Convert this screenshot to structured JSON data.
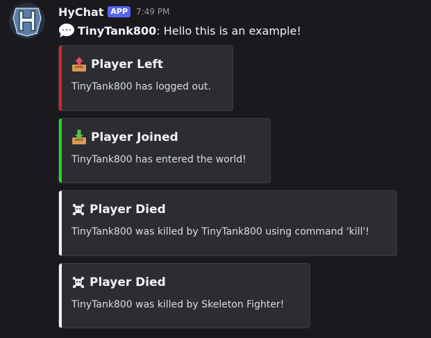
{
  "message": {
    "username": "HyChat",
    "badge": "APP",
    "time": "7:49 PM",
    "content_author": "TinyTank800",
    "content_text": ": Hello this is an example!"
  },
  "embeds": [
    {
      "title": "Player Left",
      "description": "TinyTank800 has logged out.",
      "color": "#e02222",
      "icon": "outbox-tray-icon"
    },
    {
      "title": "Player Joined",
      "description": "TinyTank800 has entered the world!",
      "color": "#22d922",
      "icon": "inbox-tray-icon"
    },
    {
      "title": "Player Died",
      "description": "TinyTank800 was killed by TinyTank800 using command 'kill'!",
      "color": "#f2f3f5",
      "icon": "skull-crossbones-icon"
    },
    {
      "title": "Player Died",
      "description": "TinyTank800 was killed by Skeleton Fighter!",
      "color": "#f2f3f5",
      "icon": "skull-crossbones-icon"
    }
  ],
  "colors": {
    "background": "#1a1a1e",
    "embed_bg": "#2b2d31",
    "badge": "#5865f2"
  }
}
